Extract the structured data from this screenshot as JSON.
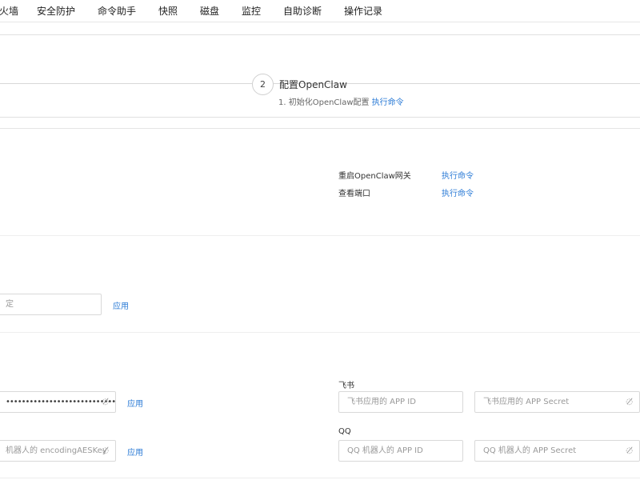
{
  "nav": {
    "items": [
      "火墙",
      "安全防护",
      "命令助手",
      "快照",
      "磁盘",
      "监控",
      "自助诊断",
      "操作记录"
    ]
  },
  "steps": {
    "number": "2",
    "title": "配置OpenClaw",
    "desc_text": "1. 初始化OpenClaw配置",
    "desc_link": "执行命令"
  },
  "gateway": {
    "rows": [
      {
        "label": "重启OpenClaw网关",
        "action": "执行命令"
      },
      {
        "label": "查看端口",
        "action": "执行命令"
      }
    ]
  },
  "single_input": {
    "placeholder": "定",
    "apply": "应用"
  },
  "left_group": {
    "row1": {
      "value": "•••••••••••••••••••••••••••••••••••••••••••••••••",
      "apply": "应用"
    },
    "row2": {
      "placeholder": "机器人的 encodingAESKey",
      "apply": "应用"
    }
  },
  "feishu": {
    "label": "飞书",
    "app_id_placeholder": "飞书应用的 APP ID",
    "app_secret_placeholder": "飞书应用的 APP Secret"
  },
  "qq": {
    "label": "QQ",
    "app_id_placeholder": "QQ 机器人的 APP ID",
    "app_secret_placeholder": "QQ 机器人的 APP Secret"
  },
  "icons": {
    "eye_off": "eye-off-icon"
  },
  "colors": {
    "link": "#2b7bd6",
    "border": "#d9d9d9"
  }
}
